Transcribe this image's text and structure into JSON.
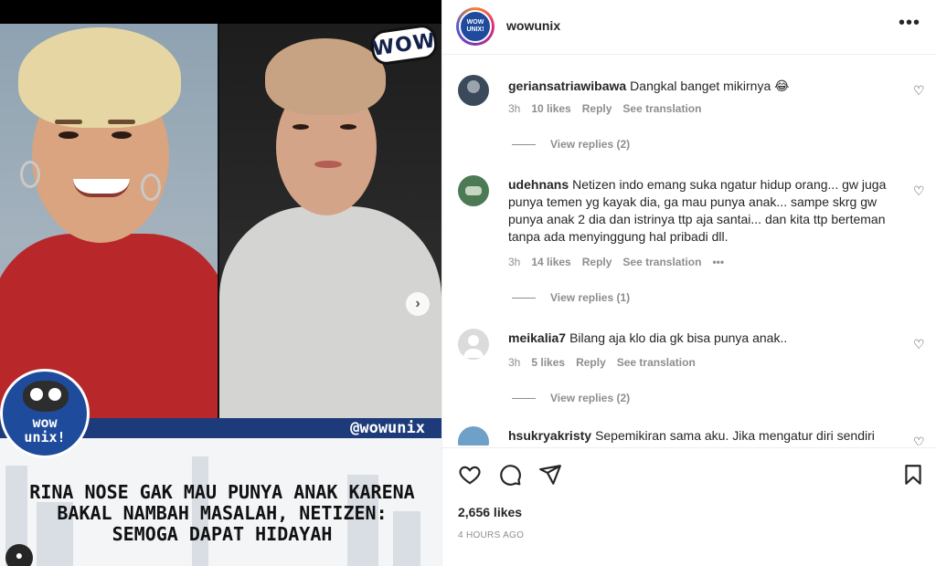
{
  "post": {
    "sticker_text": "WOW",
    "handle": "@wowunix",
    "logo": {
      "line1": "wow",
      "line2": "unix!"
    },
    "headline": "RINA NOSE GAK MAU PUNYA ANAK KARENA BAKAL NAMBAH MASALAH, NETIZEN: SEMOGA DAPAT HIDAYAH",
    "next_icon": "chevron-right-icon"
  },
  "header": {
    "username": "wowunix",
    "avatar_text": "WOW UNIX!",
    "more_icon": "more-horizontal-icon",
    "more_label": "•••"
  },
  "comments": [
    {
      "username": "geriansatriawibawa",
      "text": "Dangkal banget mikirnya 😂",
      "time": "3h",
      "likes": "10 likes",
      "reply": "Reply",
      "translate": "See translation",
      "view_replies": "View replies (2)",
      "avatar_color": "#3b4a5a"
    },
    {
      "username": "udehnans",
      "text": "Netizen indo emang suka ngatur hidup orang... gw juga punya temen yg kayak dia, ga mau punya anak... sampe skrg gw punya anak 2 dia dan istrinya ttp aja santai... dan kita ttp berteman tanpa ada menyinggung hal pribadi dll.",
      "time": "3h",
      "likes": "14 likes",
      "reply": "Reply",
      "translate": "See translation",
      "more": "•••",
      "view_replies": "View replies (1)",
      "avatar_color": "#4b7a55"
    },
    {
      "username": "meikalia7",
      "text": "Bilang aja klo dia gk bisa punya anak..",
      "time": "3h",
      "likes": "5 likes",
      "reply": "Reply",
      "translate": "See translation",
      "view_replies": "View replies (2)",
      "avatar_color": "#dbdbdb"
    },
    {
      "username": "hsukryakristy",
      "text": "Sepemikiran sama aku. Jika mengatur diri sendiri",
      "avatar_color": "#6fa0c8"
    }
  ],
  "actions": {
    "like_icon": "heart-icon",
    "comment_icon": "comment-icon",
    "share_icon": "send-icon",
    "save_icon": "bookmark-icon",
    "likes": "2,656 likes",
    "time": "4 HOURS AGO"
  }
}
